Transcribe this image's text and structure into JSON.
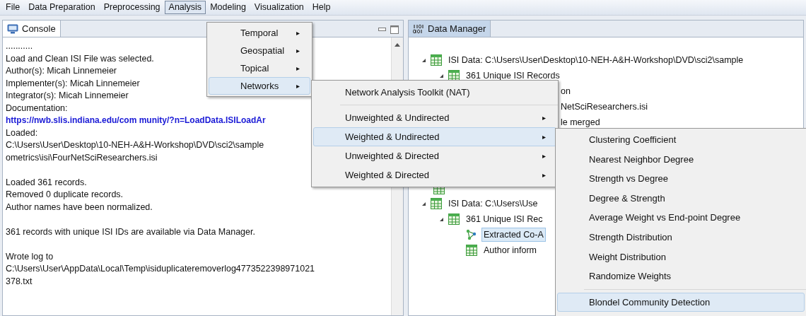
{
  "menubar": [
    {
      "label": "File",
      "selected": false
    },
    {
      "label": "Data Preparation",
      "selected": false
    },
    {
      "label": "Preprocessing",
      "selected": false
    },
    {
      "label": "Analysis",
      "selected": true
    },
    {
      "label": "Modeling",
      "selected": false
    },
    {
      "label": "Visualization",
      "selected": false
    },
    {
      "label": "Help",
      "selected": false
    }
  ],
  "console": {
    "tab": "Console",
    "lines": [
      {
        "text": "...........",
        "kind": "text"
      },
      {
        "text": "Load and Clean ISI File was selected.",
        "kind": "text"
      },
      {
        "text": "Author(s): Micah Linnemeier",
        "kind": "text"
      },
      {
        "text": "Implementer(s): Micah Linnemeier",
        "kind": "text"
      },
      {
        "text": "Integrator(s): Micah Linnemeier",
        "kind": "text"
      },
      {
        "text": "Documentation:",
        "kind": "text"
      },
      {
        "text": "https://nwb.slis.indiana.edu/com munity/?n=LoadData.ISILoadAr",
        "kind": "link"
      },
      {
        "text": "Loaded:",
        "kind": "text"
      },
      {
        "text": "C:\\Users\\User\\Desktop\\10-NEH-A&H-Workshop\\DVD\\sci2\\sample",
        "kind": "text"
      },
      {
        "text": "ometrics\\isi\\FourNetSciResearchers.isi",
        "kind": "text"
      },
      {
        "kind": "blank"
      },
      {
        "text": "Loaded 361 records.",
        "kind": "text"
      },
      {
        "text": "Removed 0 duplicate records.",
        "kind": "text"
      },
      {
        "text": "Author names have been normalized.",
        "kind": "text"
      },
      {
        "kind": "blank"
      },
      {
        "text": "361 records with unique ISI IDs are available via Data Manager.",
        "kind": "text"
      },
      {
        "kind": "blank"
      },
      {
        "text": "Wrote log to",
        "kind": "text"
      },
      {
        "text": "C:\\Users\\User\\AppData\\Local\\Temp\\isiduplicateremoverlog4773522398971021",
        "kind": "text"
      },
      {
        "text": "378.txt",
        "kind": "text"
      }
    ]
  },
  "data_manager": {
    "tab": "Data Manager",
    "tree": [
      {
        "label": "ISI Data: C:\\Users\\User\\Desktop\\10-NEH-A&H-Workshop\\DVD\\sci2\\sample",
        "kind": "table",
        "expanded": true,
        "children": [
          {
            "label": "361 Unique ISI Records",
            "kind": "table",
            "expanded": true,
            "children": [
              {
                "label": "on",
                "kind": "clipped"
              },
              {
                "label": "NetSciResearchers.isi",
                "kind": "clipped"
              },
              {
                "label": "le merged",
                "kind": "clipped"
              }
            ]
          }
        ]
      },
      {
        "label": "ISI Data: C:\\Users\\Use",
        "kind": "table",
        "expanded": true,
        "children": [
          {
            "label": "361 Unique ISI Rec",
            "kind": "table",
            "expanded": true,
            "children": [
              {
                "label": "Extracted Co-A",
                "kind": "network",
                "selected": true
              },
              {
                "label": "Author inform",
                "kind": "table",
                "selected": false
              }
            ]
          }
        ]
      }
    ]
  },
  "analysis_menu": {
    "items": [
      {
        "label": "Temporal",
        "arrow": "▸",
        "selected": false
      },
      {
        "label": "Geospatial",
        "arrow": "▸",
        "selected": false
      },
      {
        "label": "Topical",
        "arrow": "▸",
        "selected": false
      },
      {
        "label": "Networks",
        "arrow": "▸",
        "selected": true
      }
    ]
  },
  "networks_menu": {
    "items": [
      {
        "label": "Network Analysis Toolkit (NAT)",
        "kind": "item",
        "selected": false
      },
      {
        "kind": "separator"
      },
      {
        "label": "Unweighted & Undirected",
        "arrow": "▸",
        "kind": "item",
        "selected": false
      },
      {
        "label": "Weighted & Undirected",
        "arrow": "▸",
        "kind": "item",
        "selected": true
      },
      {
        "label": "Unweighted & Directed",
        "arrow": "▸",
        "kind": "item",
        "selected": false
      },
      {
        "label": "Weighted & Directed",
        "arrow": "▸",
        "kind": "item",
        "selected": false
      }
    ]
  },
  "weighted_undirected_menu": {
    "items": [
      {
        "label": "Clustering Coefficient",
        "kind": "item",
        "selected": false
      },
      {
        "label": "Nearest Neighbor Degree",
        "kind": "item",
        "selected": false
      },
      {
        "label": "Strength vs Degree",
        "kind": "item",
        "selected": false
      },
      {
        "label": "Degree & Strength",
        "kind": "item",
        "selected": false
      },
      {
        "label": "Average Weight vs End-point Degree",
        "kind": "item",
        "selected": false
      },
      {
        "label": "Strength Distribution",
        "kind": "item",
        "selected": false
      },
      {
        "label": "Weight Distribution",
        "kind": "item",
        "selected": false
      },
      {
        "label": "Randomize Weights",
        "kind": "item",
        "selected": false
      },
      {
        "kind": "separator"
      },
      {
        "label": "Blondel Community Detection",
        "kind": "item",
        "selected": true
      }
    ]
  }
}
